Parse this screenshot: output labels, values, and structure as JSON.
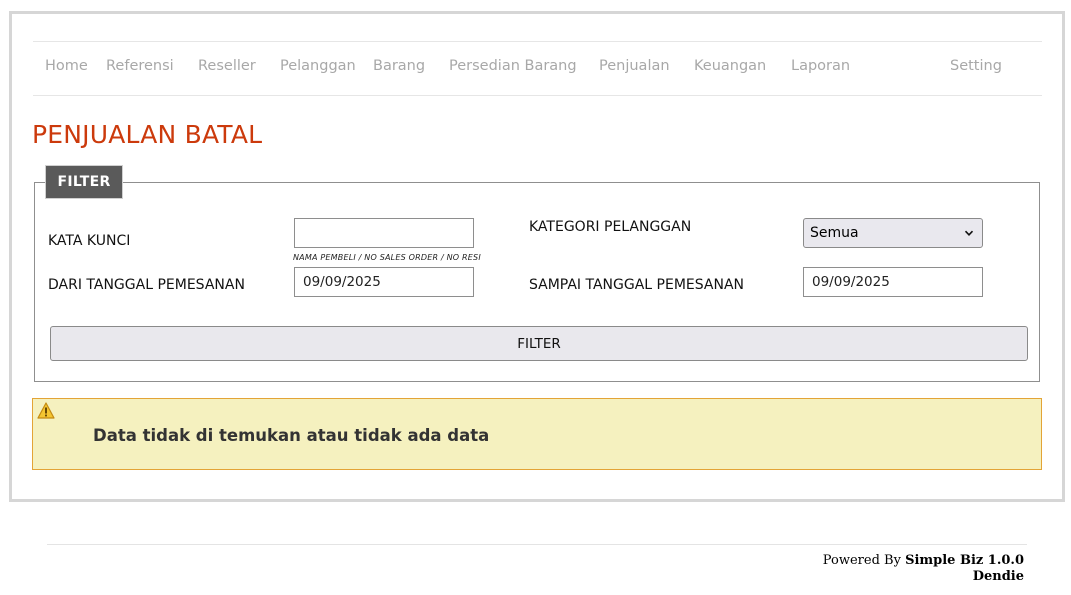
{
  "nav": {
    "items": [
      {
        "label": "Home"
      },
      {
        "label": "Referensi"
      },
      {
        "label": "Reseller"
      },
      {
        "label": "Pelanggan"
      },
      {
        "label": "Barang"
      },
      {
        "label": "Persedian Barang"
      },
      {
        "label": "Penjualan"
      },
      {
        "label": "Keuangan"
      },
      {
        "label": "Laporan"
      },
      {
        "label": "Setting"
      }
    ]
  },
  "page": {
    "title": "PENJUALAN BATAL"
  },
  "filter": {
    "tab_label": "FILTER",
    "keyword_label": "KATA KUNCI",
    "keyword_value": "",
    "keyword_hint": "NAMA PEMBELI / NO SALES ORDER / NO RESI",
    "category_label": "KATEGORI PELANGGAN",
    "category_selected": "Semua",
    "from_date_label": "DARI TANGGAL PEMESANAN",
    "from_date_value": "09/09/2025",
    "to_date_label": "SAMPAI TANGGAL PEMESANAN",
    "to_date_value": "09/09/2025",
    "button_label": "FILTER"
  },
  "alert": {
    "message": "Data tidak di temukan atau tidak ada data",
    "icon": "warning-icon",
    "background": "#f5f1bf",
    "border": "#e3a436"
  },
  "footer": {
    "powered_prefix": "Powered By ",
    "product": "Simple Biz 1.0.0",
    "author": "Dendie"
  },
  "colors": {
    "accent": "#cc3a0c",
    "nav_text": "#a8a8a8",
    "tab_bg": "#5a5a5a"
  }
}
